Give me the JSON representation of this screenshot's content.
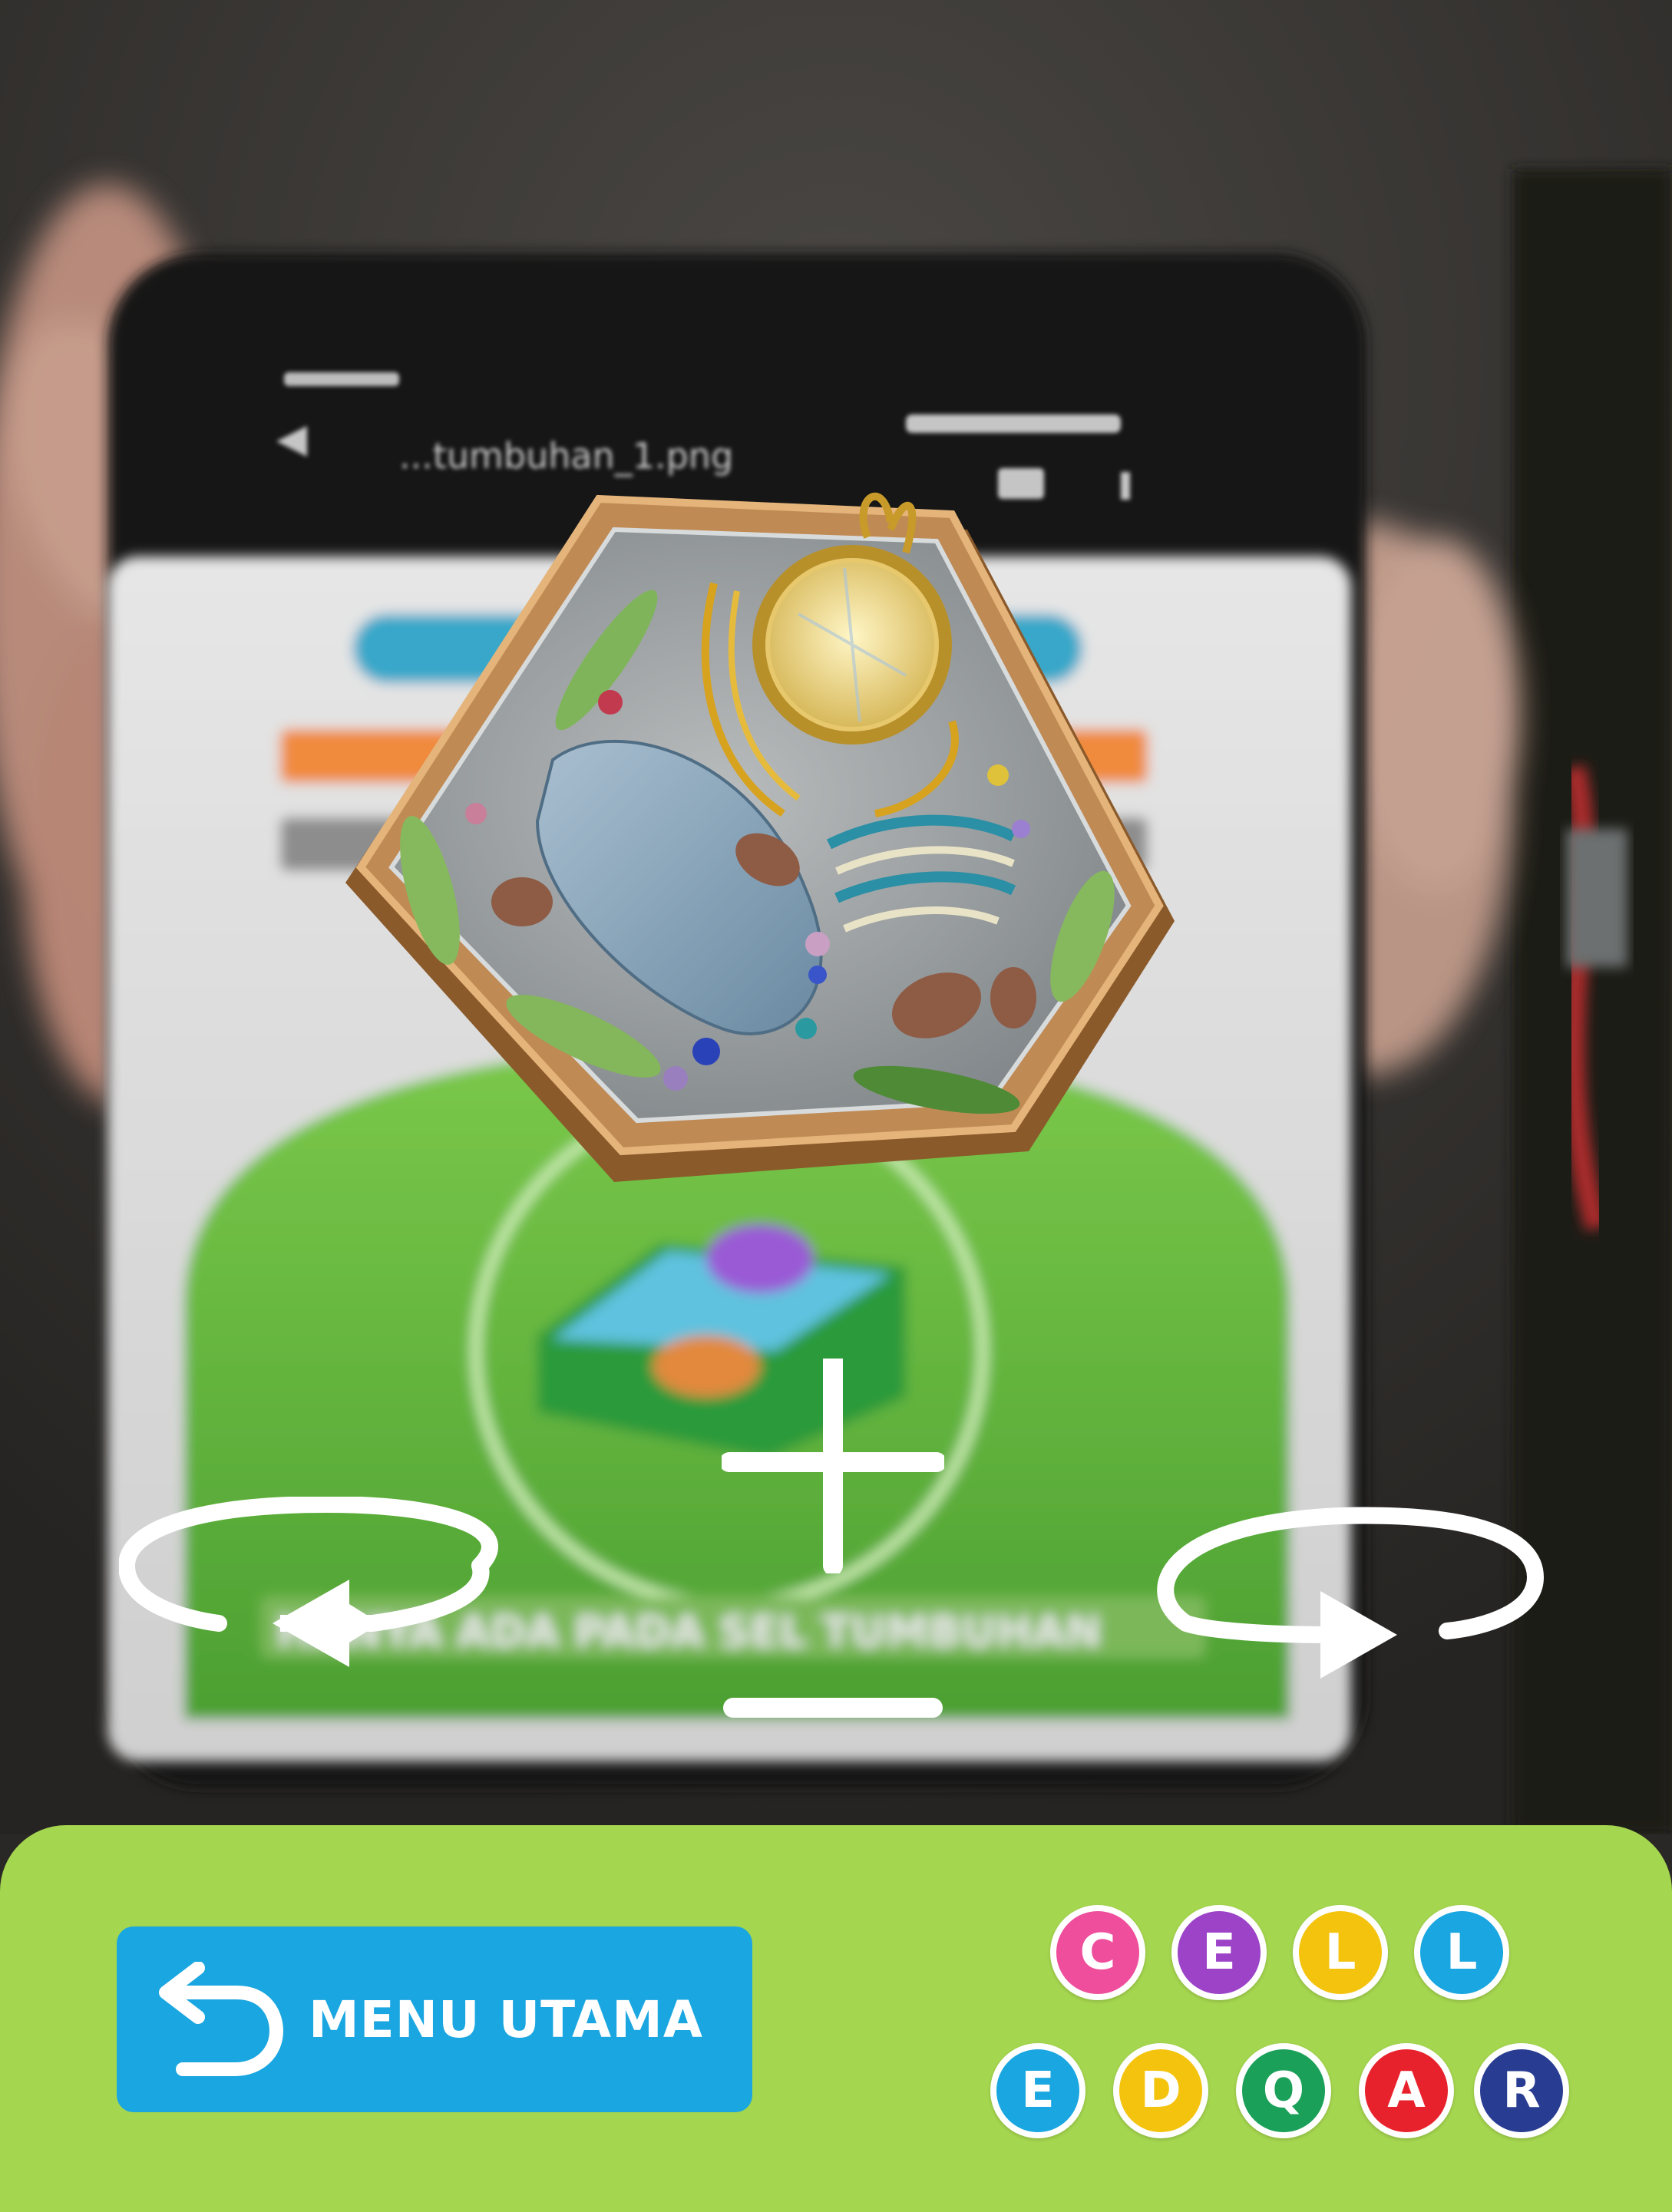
{
  "screen": {
    "phone_title": "...tumbuhan_1.png",
    "phone_bottom_banner": "HANYA ADA PADA SEL TUMBUHAN"
  },
  "controls": {
    "zoom_in_icon": "plus-icon",
    "zoom_out_icon": "minus-icon",
    "rotate_left_icon": "rotate-left-icon",
    "rotate_right_icon": "rotate-right-icon"
  },
  "bottom_bar": {
    "menu_button": {
      "label": "MENU UTAMA",
      "icon": "back-arrow-icon",
      "color": "#1aa6e0"
    },
    "background_color": "#a5d64f"
  },
  "logo": {
    "row1": [
      {
        "letter": "C",
        "color": "#ee4e9c"
      },
      {
        "letter": "E",
        "color": "#9c43c7"
      },
      {
        "letter": "L",
        "color": "#f4c30e"
      },
      {
        "letter": "L",
        "color": "#1aa6e0"
      }
    ],
    "row2": [
      {
        "letter": "E",
        "color": "#1aa6e0"
      },
      {
        "letter": "D",
        "color": "#f4c30e"
      },
      {
        "letter": "Q",
        "color": "#1aa058"
      },
      {
        "letter": "A",
        "color": "#e8222c"
      },
      {
        "letter": "R",
        "color": "#283c92"
      }
    ]
  }
}
